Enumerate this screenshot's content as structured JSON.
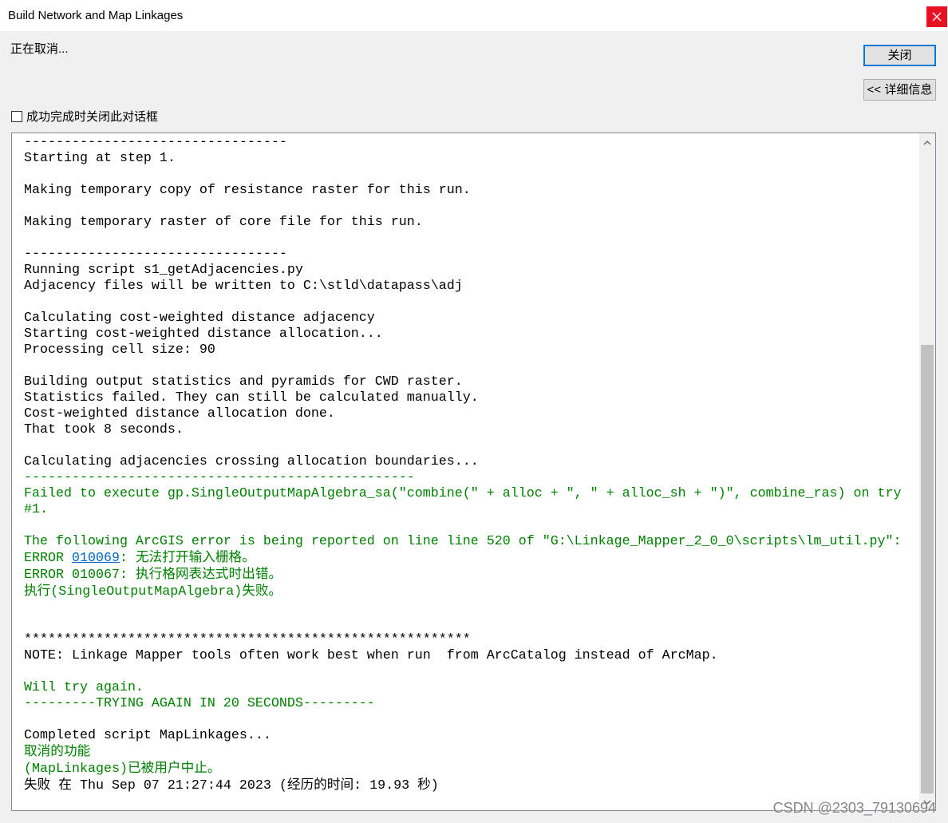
{
  "window": {
    "title": "Build Network and Map Linkages"
  },
  "status": {
    "text": "正在取消..."
  },
  "buttons": {
    "close_label": "关闭",
    "details_label": "<< 详细信息"
  },
  "options": {
    "close_on_success_label": "成功完成时关闭此对话框",
    "close_on_success_checked": false
  },
  "log": {
    "lines": [
      {
        "text": "---------------------------------",
        "color": "black"
      },
      {
        "text": "Starting at step 1.",
        "color": "black"
      },
      {
        "text": ""
      },
      {
        "text": "Making temporary copy of resistance raster for this run.",
        "color": "black"
      },
      {
        "text": ""
      },
      {
        "text": "Making temporary raster of core file for this run.",
        "color": "black"
      },
      {
        "text": ""
      },
      {
        "text": "---------------------------------",
        "color": "black"
      },
      {
        "text": "Running script s1_getAdjacencies.py",
        "color": "black"
      },
      {
        "text": "Adjacency files will be written to C:\\stld\\datapass\\adj",
        "color": "black"
      },
      {
        "text": ""
      },
      {
        "text": "Calculating cost-weighted distance adjacency",
        "color": "black"
      },
      {
        "text": "Starting cost-weighted distance allocation...",
        "color": "black"
      },
      {
        "text": "Processing cell size: 90",
        "color": "black"
      },
      {
        "text": ""
      },
      {
        "text": "Building output statistics and pyramids for CWD raster.",
        "color": "black"
      },
      {
        "text": "Statistics failed. They can still be calculated manually.",
        "color": "black"
      },
      {
        "text": "Cost-weighted distance allocation done.",
        "color": "black"
      },
      {
        "text": "That took 8 seconds.",
        "color": "black"
      },
      {
        "text": ""
      },
      {
        "text": "Calculating adjacencies crossing allocation boundaries...",
        "color": "black"
      },
      {
        "text": "-------------------------------------------------",
        "color": "green"
      },
      {
        "text": "Failed to execute gp.SingleOutputMapAlgebra_sa(\"combine(\" + alloc + \", \" + alloc_sh + \")\", combine_ras) on try",
        "color": "green"
      },
      {
        "text": "#1.",
        "color": "green"
      },
      {
        "text": ""
      },
      {
        "text": "The following ArcGIS error is being reported on line line 520 of \"G:\\Linkage_Mapper_2_0_0\\scripts\\lm_util.py\":",
        "color": "green"
      },
      {
        "segments": [
          {
            "text": "ERROR ",
            "color": "green"
          },
          {
            "text": "010069",
            "color": "blue",
            "link": true
          },
          {
            "text": ": 无法打开输入栅格。",
            "color": "green"
          }
        ]
      },
      {
        "text": "ERROR 010067: 执行格网表达式时出错。",
        "color": "green"
      },
      {
        "text": "执行(SingleOutputMapAlgebra)失败。",
        "color": "green"
      },
      {
        "text": ""
      },
      {
        "text": ""
      },
      {
        "text": "********************************************************",
        "color": "black"
      },
      {
        "text": "NOTE: Linkage Mapper tools often work best when run  from ArcCatalog instead of ArcMap.",
        "color": "black"
      },
      {
        "text": ""
      },
      {
        "text": "Will try again.",
        "color": "green"
      },
      {
        "text": "---------TRYING AGAIN IN 20 SECONDS---------",
        "color": "green"
      },
      {
        "text": ""
      },
      {
        "text": "Completed script MapLinkages...",
        "color": "black"
      },
      {
        "text": "取消的功能",
        "color": "green"
      },
      {
        "text": "(MapLinkages)已被用户中止。",
        "color": "green"
      },
      {
        "text": "失败 在 Thu Sep 07 21:27:44 2023 (经历的时间: 19.93 秒)",
        "color": "black"
      }
    ]
  },
  "scrollbar": {
    "scroll_percent": 100
  },
  "watermark": {
    "text": "CSDN @2303_79130694"
  },
  "icons": {
    "window_close": "close-icon",
    "scroll_up": "chevron-up-icon",
    "scroll_down": "chevron-down-icon"
  },
  "colors": {
    "black": "#000000",
    "green": "#008000",
    "blue": "#0066cc",
    "close_button": "#e81123",
    "default_button_border": "#0078d7"
  }
}
